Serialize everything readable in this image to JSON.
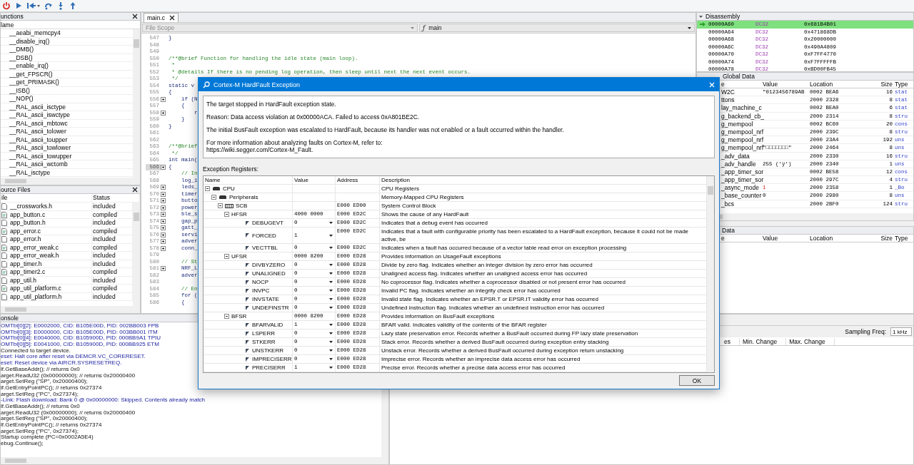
{
  "toolbar": {
    "buttons": [
      {
        "kind": "power"
      },
      {
        "kind": "run"
      },
      {
        "kind": "reset"
      },
      {
        "kind": "step-over"
      },
      {
        "kind": "step-into"
      },
      {
        "kind": "step-out"
      }
    ]
  },
  "functions": {
    "title": "unctions",
    "column": "lame",
    "items": [
      "__aeabi_memcpy4",
      "__disable_irq()",
      "__DMB()",
      "__DSB()",
      "__enable_irq()",
      "__get_FPSCR()",
      "__get_PRIMASK()",
      "__ISB()",
      "__NOP()",
      "__RAL_ascii_isctype",
      "__RAL_ascii_iswctype",
      "__RAL_ascii_mbtowc",
      "__RAL_ascii_tolower",
      "__RAL_ascii_toupper",
      "__RAL_ascii_towlower",
      "__RAL_ascii_towupper",
      "__RAL_ascii_wctomb",
      "__RAL_isctype"
    ]
  },
  "source_files": {
    "title": "ource Files",
    "columns": [
      "ile",
      "Status"
    ],
    "rows": [
      {
        "name": "__crossworks.h",
        "status": "included",
        "kind": "header"
      },
      {
        "name": "app_button.c",
        "status": "compiled",
        "kind": "source"
      },
      {
        "name": "app_button.h",
        "status": "included",
        "kind": "header"
      },
      {
        "name": "app_error.c",
        "status": "compiled",
        "kind": "source"
      },
      {
        "name": "app_error.h",
        "status": "included",
        "kind": "header"
      },
      {
        "name": "app_error_weak.c",
        "status": "compiled",
        "kind": "source"
      },
      {
        "name": "app_error_weak.h",
        "status": "included",
        "kind": "header"
      },
      {
        "name": "app_timer.h",
        "status": "included",
        "kind": "header"
      },
      {
        "name": "app_timer2.c",
        "status": "compiled",
        "kind": "source"
      },
      {
        "name": "app_util.h",
        "status": "included",
        "kind": "header"
      },
      {
        "name": "app_util_platform.c",
        "status": "compiled",
        "kind": "source"
      },
      {
        "name": "app_util_platform.h",
        "status": "included",
        "kind": "header"
      }
    ]
  },
  "editor": {
    "tab": "main.c",
    "scope": "File Scope",
    "function_icon": "ƒ",
    "function": "main",
    "lines": [
      {
        "num": "547",
        "text": "}",
        "kind": "code",
        "fold": false,
        "current": false
      },
      {
        "num": "548",
        "fold": false,
        "current": false
      },
      {
        "num": "549",
        "fold": false,
        "current": false
      },
      {
        "num": "550",
        "text": "/**@brief Function for handling the idle state (main loop).",
        "kind": "comment",
        "fold": false,
        "current": false
      },
      {
        "num": "551",
        "text": " *",
        "kind": "comment",
        "fold": false,
        "current": false
      },
      {
        "num": "552",
        "text": " * @details If there is no pending log operation, then sleep until next the next event occurs.",
        "kind": "comment",
        "fold": false,
        "current": false
      },
      {
        "num": "553",
        "text": " */",
        "kind": "comment",
        "fold": false,
        "current": false
      },
      {
        "num": "554",
        "text": "static v",
        "kind": "code",
        "fold": false,
        "current": false
      },
      {
        "num": "555",
        "text": "{",
        "kind": "code",
        "fold": false,
        "current": false
      },
      {
        "num": "556",
        "text": "    if (N",
        "kind": "code",
        "fold": true,
        "current": false
      },
      {
        "num": "557",
        "text": "    {",
        "kind": "code",
        "fold": false,
        "current": false
      },
      {
        "num": "558",
        "text": "        r",
        "kind": "code",
        "fold": true,
        "current": false
      },
      {
        "num": "559",
        "text": "    }",
        "kind": "code",
        "fold": false,
        "current": false
      },
      {
        "num": "560",
        "text": "}",
        "kind": "code",
        "fold": false,
        "current": false
      },
      {
        "num": "561",
        "fold": false,
        "current": false
      },
      {
        "num": "562",
        "fold": false,
        "current": false
      },
      {
        "num": "563",
        "text": "/**@brief",
        "kind": "comment",
        "fold": false,
        "current": false
      },
      {
        "num": "564",
        "text": " */",
        "kind": "comment",
        "fold": false,
        "current": false
      },
      {
        "num": "565",
        "text": "int main(",
        "kind": "code",
        "fold": false,
        "current": false
      },
      {
        "num": "566",
        "text": "{",
        "kind": "code",
        "fold": true,
        "current": true
      },
      {
        "num": "567",
        "text": "    // In",
        "kind": "comment",
        "fold": false,
        "current": false
      },
      {
        "num": "568",
        "text": "    log_i",
        "kind": "code",
        "fold": false,
        "current": false
      },
      {
        "num": "569",
        "text": "    leds_",
        "kind": "code",
        "fold": true,
        "current": false
      },
      {
        "num": "570",
        "text": "    timer",
        "kind": "code",
        "fold": true,
        "current": false
      },
      {
        "num": "571",
        "text": "    butto",
        "kind": "code",
        "fold": true,
        "current": false
      },
      {
        "num": "572",
        "text": "    power",
        "kind": "code",
        "fold": true,
        "current": false
      },
      {
        "num": "573",
        "text": "    ble_s",
        "kind": "code",
        "fold": true,
        "current": false
      },
      {
        "num": "574",
        "text": "    gap_p",
        "kind": "code",
        "fold": true,
        "current": false
      },
      {
        "num": "575",
        "text": "    gatt_",
        "kind": "code",
        "fold": true,
        "current": false
      },
      {
        "num": "576",
        "text": "    servi",
        "kind": "code",
        "fold": true,
        "current": false
      },
      {
        "num": "577",
        "text": "    adver",
        "kind": "code",
        "fold": true,
        "current": false
      },
      {
        "num": "578",
        "text": "    conn_",
        "kind": "code",
        "fold": true,
        "current": false
      },
      {
        "num": "579",
        "fold": false,
        "current": false
      },
      {
        "num": "580",
        "text": "    // St",
        "kind": "comment",
        "fold": false,
        "current": false
      },
      {
        "num": "581",
        "text": "    NRF_L",
        "kind": "code",
        "fold": true,
        "current": false
      },
      {
        "num": "582",
        "text": "    adver",
        "kind": "code",
        "fold": false,
        "current": false
      },
      {
        "num": "583",
        "fold": false,
        "current": false
      },
      {
        "num": "584",
        "text": "    // En",
        "kind": "comment",
        "fold": false,
        "current": false
      },
      {
        "num": "585",
        "text": "    for (",
        "kind": "code",
        "fold": false,
        "current": false
      },
      {
        "num": "586",
        "text": "    {",
        "kind": "code",
        "fold": false,
        "current": false
      }
    ]
  },
  "disassembly": {
    "title": "Disassembly",
    "rows": [
      {
        "address": "00000A60",
        "mnemonic": "DC32",
        "operand": "0x681B4B01",
        "current": true
      },
      {
        "address": "00000A64",
        "mnemonic": "DC32",
        "operand": "0x471868DB",
        "current": false
      },
      {
        "address": "00000A68",
        "mnemonic": "DC32",
        "operand": "0x20000000",
        "current": false
      },
      {
        "address": "00000A6C",
        "mnemonic": "DC32",
        "operand": "0x490A4809",
        "current": false
      },
      {
        "address": "00000A70",
        "mnemonic": "DC32",
        "operand": "0xF7FF4770",
        "current": false
      },
      {
        "address": "00000A74",
        "mnemonic": "DC32",
        "operand": "0xF7FFFFFB",
        "current": false
      },
      {
        "address": "00000A78",
        "mnemonic": "DC32",
        "operand": "0xBD00FB45",
        "current": false
      }
    ]
  },
  "global_data": {
    "title": "Global Data",
    "columns": [
      "e",
      "Value",
      "Location",
      "Size",
      "Type"
    ],
    "rows": [
      {
        "name": "W2C",
        "value": "\"0123456789AB",
        "location": "0002 BEA6",
        "size": "16",
        "type": "stat",
        "changed": false
      },
      {
        "name": "ttons",
        "location": "2000 2328",
        "size": "8",
        "type": "stat"
      },
      {
        "name": "lay_machine_c",
        "location": "0002 BEA0",
        "size": "6",
        "type": "stat"
      },
      {
        "name": "g_backend_cb_",
        "location": "2000 2314",
        "size": "8",
        "type": "stru"
      },
      {
        "name": "g_mempool",
        "location": "0002 BC60",
        "size": "20",
        "type": "cons"
      },
      {
        "name": "g_mempool_nrf",
        "location": "2000 239C",
        "size": "8",
        "type": "stru"
      },
      {
        "name": "g_mempool_nrf",
        "location": "2000 23A4",
        "size": "192",
        "type": "uns"
      },
      {
        "name": "g_mempool_nrf",
        "value": "\"□□□□□□□\"",
        "location": "2000 2464",
        "size": "8",
        "type": "uns",
        "changed": false
      },
      {
        "name": "_adv_data",
        "location": "2000 2330",
        "size": "16",
        "type": "stru"
      },
      {
        "name": "_adv_handle",
        "value": "255 ('ÿ')",
        "location": "2000 2340",
        "size": "1",
        "type": "uns",
        "changed": false
      },
      {
        "name": "_app_timer_sor",
        "location": "0002 BE58",
        "size": "12",
        "type": "cons"
      },
      {
        "name": "_app_timer_sor",
        "location": "2000 297C",
        "size": "4",
        "type": "stru"
      },
      {
        "name": "_async_mode",
        "value": "1",
        "location": "2000 2358",
        "size": "1",
        "type": "_Bo",
        "changed": true
      },
      {
        "name": "_base_counter",
        "value": "0",
        "location": "2000 2980",
        "size": "8",
        "type": "uns",
        "changed": false
      },
      {
        "name": "_bcs",
        "location": "2000 2BF0",
        "size": "124",
        "type": "stru"
      }
    ]
  },
  "local_data": {
    "title": "Data",
    "columns": [
      "e",
      "Value",
      "Location",
      "Size",
      "Type"
    ]
  },
  "console": {
    "title": "onsole",
    "lines": [
      {
        "text": "OMTbl[0][2]: E0002000, CID: B105E00D, PID: 002BB003 FPB",
        "kind": "info"
      },
      {
        "text": "OMTbl[0][3]: E0000000, CID: B105E00D, PID: 003BB001 ITM",
        "kind": "info"
      },
      {
        "text": "OMTbl[0][4]: E0040000, CID: B105900D, PID: 000BB9A1 TPIU",
        "kind": "info"
      },
      {
        "text": "OMTbl[0][5]: E0041000, CID: B105900D, PID: 000BB925 ETM",
        "kind": "info"
      },
      {
        "text": "Connected to target device.",
        "kind": "plain"
      },
      {
        "text": "eset: Halt core after reset via DEMCR.VC_CORERESET.",
        "kind": "info"
      },
      {
        "text": "eset: Reset device via AIRCR.SYSRESETREQ.",
        "kind": "info"
      },
      {
        "text": "lf.GetBaseAddr(); // returns 0x0",
        "kind": "plain"
      },
      {
        "text": "arget.ReadU32 (0x00000000); // returns 0x20000400",
        "kind": "plain"
      },
      {
        "text": "arget.SetReg (\"SP\", 0x20000400);",
        "kind": "plain"
      },
      {
        "text": "lf.GetEntryPointPC(); // returns 0x27374",
        "kind": "plain"
      },
      {
        "text": "arget.SetReg (\"PC\", 0x27374);",
        "kind": "plain"
      },
      {
        "text": "-Link: Flash download: Bank 0 @ 0x00000000: Skipped. Contents already match",
        "kind": "info"
      },
      {
        "text": "lf.GetBaseAddr(); // returns 0x0",
        "kind": "plain"
      },
      {
        "text": "arget.ReadU32 (0x00000000); // returns 0x20000400",
        "kind": "plain"
      },
      {
        "text": "arget.SetReg (\"SP\", 0x20000400);",
        "kind": "plain"
      },
      {
        "text": "lf.GetEntryPointPC(); // returns 0x27374",
        "kind": "plain"
      },
      {
        "text": "arget.SetReg (\"PC\", 0x27374);",
        "kind": "plain"
      },
      {
        "text": "Startup complete (PC=0x0002A5E4)",
        "kind": "plain"
      },
      {
        "text": "ebug.Continue();",
        "kind": "plain"
      }
    ]
  },
  "power_panel": {
    "sampling_label": "Sampling Freq:",
    "sampling_value": "1 kHz",
    "columns": [
      "es",
      "Min. Change",
      "Max. Change"
    ]
  },
  "dialog": {
    "title": "Cortex-M HardFault Exception",
    "messages": [
      "The target stopped in HardFault exception state.",
      "Reason: Data access violation at 0x00000ACA. Failed to access 0xA801BE2C.",
      "The initial BusFault exception was escalated to HardFault, because its handler was not enabled or a fault occurred within the handler."
    ],
    "info_text": "For more information about analyzing faults on Cortex-M, refer to:",
    "info_link": "https://wiki.segger.com/Cortex-M_Fault.",
    "registers_label": "Exception Registers:",
    "columns": [
      "Name",
      "Value",
      "Address",
      "Description"
    ],
    "registers": [
      {
        "kind": "group",
        "name": "CPU",
        "description": "CPU Registers",
        "expanded": true,
        "children": [
          {
            "kind": "group",
            "name": "Peripherals",
            "description": "Memory-Mapped CPU Registers",
            "expanded": true,
            "children": [
              {
                "kind": "block",
                "name": "SCB",
                "address": "E000 ED00",
                "description": "System Control Block",
                "expanded": true,
                "children": [
                  {
                    "kind": "register",
                    "name": "HFSR",
                    "value": "4000 0000",
                    "address": "E000 ED2C",
                    "description": "Shows the cause of any HardFault",
                    "expanded": true,
                    "children": [
                      {
                        "kind": "field",
                        "name": "DEBUGEVT",
                        "value": "0",
                        "address": "E000 ED2C",
                        "description": "Indicates that a debug event has occurred"
                      },
                      {
                        "kind": "field",
                        "name": "FORCED",
                        "value": "1",
                        "address": "E000 ED2C",
                        "description": "Indicates that a fault with configurable priority has been escalated to a HardFault exception, because it could not be made active, be"
                      },
                      {
                        "kind": "field",
                        "name": "VECTTBL",
                        "value": "0",
                        "address": "E000 ED2C",
                        "description": "Indicates when a fault has occurred because of a vector table read error on exception processing"
                      }
                    ]
                  },
                  {
                    "kind": "register",
                    "name": "UFSR",
                    "value": "0000 8200",
                    "address": "E000 ED28",
                    "description": "Provides information on UsageFault exceptions",
                    "expanded": true,
                    "children": [
                      {
                        "kind": "field",
                        "name": "DIVBYZERO",
                        "value": "0",
                        "address": "E000 ED28",
                        "description": "Divide by zero flag. Indicates whether an integer division by zero error has occurred"
                      },
                      {
                        "kind": "field",
                        "name": "UNALIGNED",
                        "value": "0",
                        "address": "E000 ED28",
                        "description": "Unaligned access flag. Indicates whether an unaligned access error has occurred"
                      },
                      {
                        "kind": "field",
                        "name": "NOCP",
                        "value": "0",
                        "address": "E000 ED28",
                        "description": "No coprocessor flag. Indicates whether a coprocessor disabled or not present error has occurred"
                      },
                      {
                        "kind": "field",
                        "name": "INVPC",
                        "value": "0",
                        "address": "E000 ED28",
                        "description": "Invalid PC flag. Indicates whether an integrity check error has occurred"
                      },
                      {
                        "kind": "field",
                        "name": "INVSTATE",
                        "value": "0",
                        "address": "E000 ED28",
                        "description": "Invalid state flag. Indicates whether an EPSR.T or EPSR.IT validity error has occurred"
                      },
                      {
                        "kind": "field",
                        "name": "UNDEFINSTR",
                        "value": "0",
                        "address": "E000 ED28",
                        "description": "Undefined instruction flag. Indicates whether an undefined instruction error has occurred"
                      }
                    ]
                  },
                  {
                    "kind": "register",
                    "name": "BFSR",
                    "value": "0000 8200",
                    "address": "E000 ED28",
                    "description": "Provides information on BusFault exceptions",
                    "expanded": true,
                    "children": [
                      {
                        "kind": "field",
                        "name": "BFARVALID",
                        "value": "1",
                        "address": "E000 ED28",
                        "description": "BFAR valid. Indicates validity of the contents of the BFAR register"
                      },
                      {
                        "kind": "field",
                        "name": "LSPERR",
                        "value": "0",
                        "address": "E000 ED28",
                        "description": "Lazy state preservation error. Records whether a BusFault occurred during FP lazy state preservation"
                      },
                      {
                        "kind": "field",
                        "name": "STKERR",
                        "value": "0",
                        "address": "E000 ED28",
                        "description": "Stack error. Records whether a derived BusFault occurred during exception entry stacking"
                      },
                      {
                        "kind": "field",
                        "name": "UNSTKERR",
                        "value": "0",
                        "address": "E000 ED28",
                        "description": "Unstack error. Records whether a derived BusFault occurred during exception return unstacking"
                      },
                      {
                        "kind": "field",
                        "name": "IMPRECISERR",
                        "value": "0",
                        "address": "E000 ED28",
                        "description": "Imprecise error. Records whether an imprecise data access error has occurred"
                      },
                      {
                        "kind": "field",
                        "name": "PRECISERR",
                        "value": "1",
                        "address": "E000 ED28",
                        "description": "Precise error. Records whether a precise data access error has occurred"
                      }
                    ]
                  }
                ]
              }
            ]
          }
        ]
      }
    ],
    "ok_button": "OK"
  }
}
